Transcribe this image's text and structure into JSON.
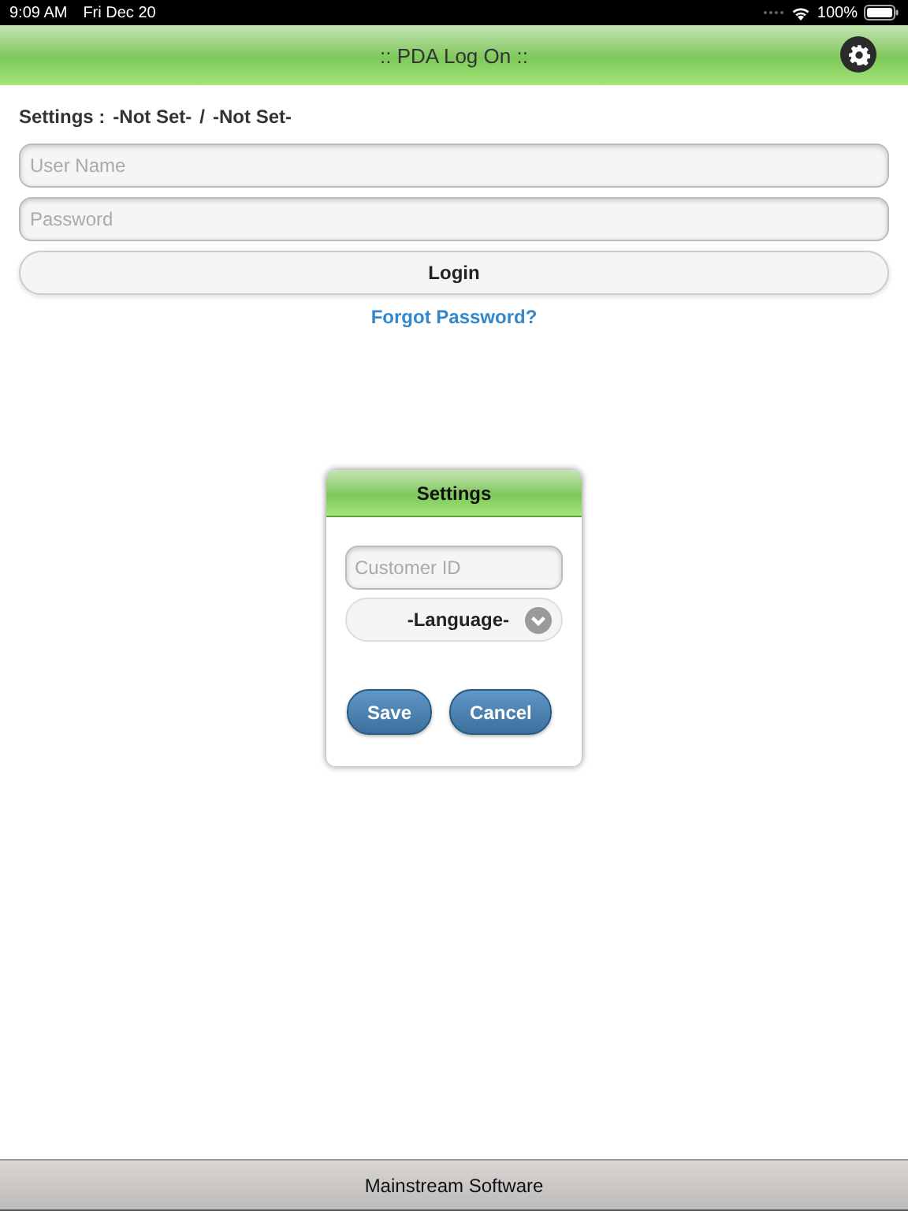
{
  "status_bar": {
    "time": "9:09 AM",
    "date": "Fri Dec 20",
    "battery": "100%"
  },
  "header": {
    "title": ":: PDA Log On ::"
  },
  "settings_summary": {
    "label": "Settings :",
    "customer": "-Not Set-",
    "separator": "/",
    "language": "-Not Set-"
  },
  "login_form": {
    "username": {
      "placeholder": "User Name"
    },
    "password": {
      "placeholder": "Password"
    },
    "login_button": "Login",
    "forgot_link": "Forgot Password?"
  },
  "settings_dialog": {
    "title": "Settings",
    "customer_id": {
      "placeholder": "Customer ID"
    },
    "language": "-Language-",
    "buttons": [
      "Save",
      "Cancel"
    ]
  },
  "footer": {
    "text": "Mainstream Software"
  }
}
